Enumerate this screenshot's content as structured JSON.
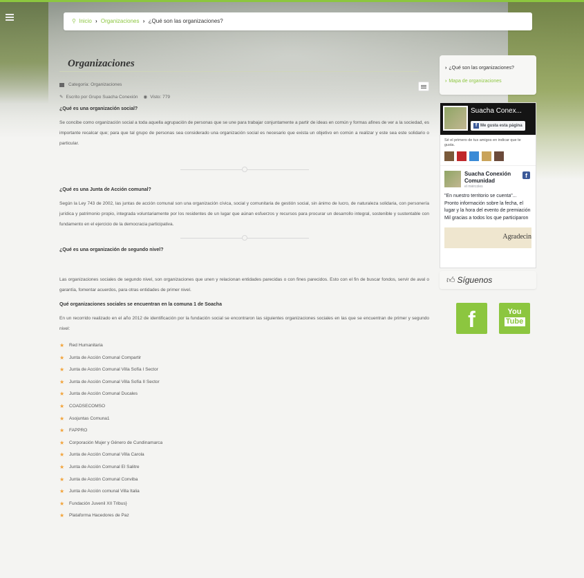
{
  "breadcrumb": {
    "home": "Inicio",
    "parent": "Organizaciones",
    "current": "¿Qué son las organizaciones?"
  },
  "main": {
    "title": "Organizaciones",
    "meta": {
      "category": "Categoría: Organizaciones",
      "author": "Escrito por Grupo Suacha Conexión",
      "visits": "Visto: 779"
    },
    "s1": {
      "heading": "¿Qué es una organización social?",
      "text": "Se concibe como organización social a toda aquella agrupación de personas que se une para trabajar conjuntamente a partir de ideas en común y formas afines  de ver a la sociedad,  es importante recalcar que; para que  tal grupo de personas sea considerado una organización social es necesario que exista un objetivo en común a realizar y este sea este solidario o particular."
    },
    "s2": {
      "heading": "¿Qué es una Junta de Acción comunal?",
      "text": "Según la Ley 743 de 2002, las juntas de acción comunal son una organización cívica, social y comunitaria de gestión social, sin ánimo de lucro, de naturaleza solidaria, con personería jurídica y patrimonio propio, integrada voluntariamente por los residentes de un lugar que aúnan esfuerzos y recursos para procurar un desarrollo integral, sostenible y sustentable con fundamento en el ejercicio de la democracia participativa."
    },
    "s3": {
      "heading": "¿Qué es una organización de segundo nivel?",
      "text": "Las organizaciones sociales  de segundo nivel, son organizaciones que unen y relacionan entidades parecidas o con fines parecidos. Esto con el fin de buscar fondos, servir de aval o garantía, fomentar acuerdos, para otras entidades de primer nivel."
    },
    "s4": {
      "heading": "Qué organizaciones sociales se encuentran en la comuna 1 de Soacha",
      "text": "En un recorrido realizado en el año 2012 de identificación por la fundación social se encontraron las siguientes organizaciones sociales en las que se encuentran de primer y segundo nivel:"
    },
    "orgs": [
      "Red Humanitaria",
      "Junta de Acción Comunal Compartir",
      "Junta de Acción Comunal Villa Sofía I Sector",
      "Junta de Acción Comunal Villa Sofía II Sector",
      "Junta de Acción Comunal Ducales",
      "COADSECOMSO",
      "Asojuntas Comuna1",
      "FAPPRO",
      "Corporación Mujer y Género de Cundinamarca",
      "Junta de Acción Comunal Villa Carola",
      "Junta de Acción  Comunal El Salitre",
      "Junta de Acción Comunal Conviba",
      "Junta de Acción comunal Villa Italia",
      "Fundación Juvenil XII Tribus}",
      "Plataforma Hacedores de Paz"
    ]
  },
  "sidebar": {
    "menu": {
      "active": "¿Qué son las organizaciones?",
      "link": "Mapa de organizaciones"
    },
    "fb": {
      "page_name": "Suacha Conex...",
      "like_label": "Me gusta esta página",
      "friends_text": "Sé el primero de tus amigos en indicar que te gusta.",
      "post_author": "Suacha Conexión Comunidad",
      "post_time": "el miércoles",
      "post_text": "\"En nuestro territorio se cuenta\"... Pronto información sobre la fecha, el lugar y la hora del evento de premiación Mil gracias a todos los que participaron",
      "post_image_text": "Agradecin"
    },
    "follow_label": "Síguenos",
    "youtube": {
      "top": "You",
      "bottom": "Tube"
    },
    "facebook_glyph": "f"
  },
  "colors": {
    "accent": "#8cc63f",
    "star": "#f2a33a",
    "facebook": "#3b5998"
  }
}
